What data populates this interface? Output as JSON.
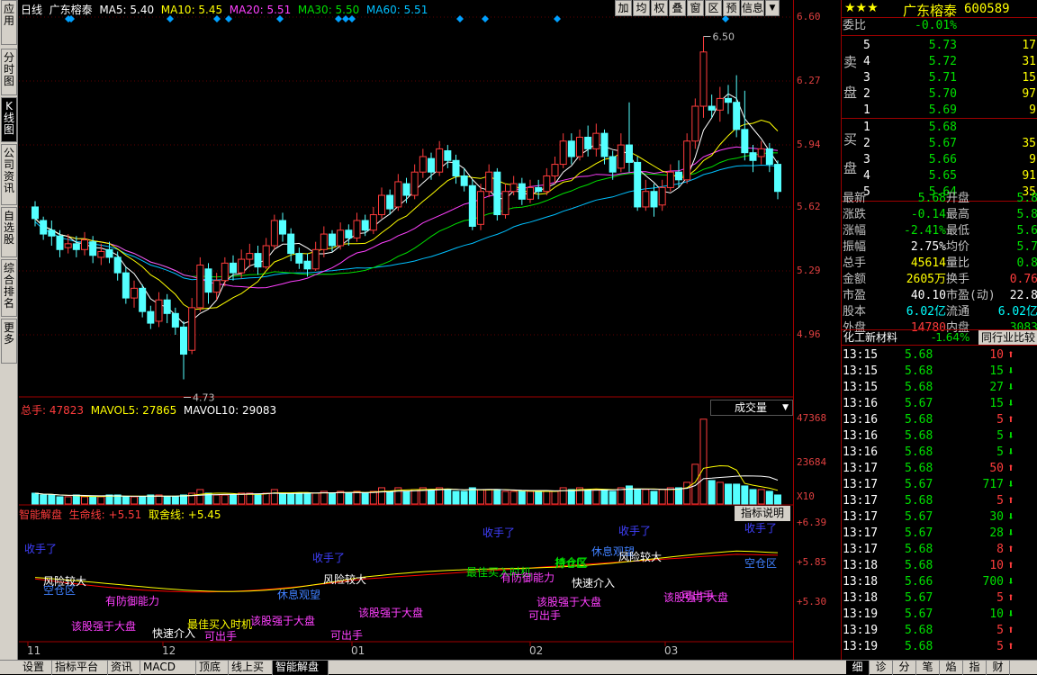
{
  "colors": {
    "up": "#ff3c3c",
    "down": "#54ffff",
    "ma5": "#ffffff",
    "ma10": "#ffff00",
    "ma20": "#ff40ff",
    "ma30": "#00e000",
    "ma60": "#00c0ff",
    "axis": "#a00000"
  },
  "left_tabs": [
    "应用",
    "分时图",
    "K线图",
    "公司资讯",
    "自选股",
    "综合排名",
    "更多"
  ],
  "header": {
    "period": "日线",
    "stock": "广东榕泰",
    "ma5": "MA5: 5.40",
    "ma10": "MA10: 5.45",
    "ma20": "MA20: 5.51",
    "ma30": "MA30: 5.50",
    "ma60": "MA60: 5.51"
  },
  "toolbar": [
    "加",
    "均",
    "权",
    "叠",
    "窗",
    "区",
    "预",
    "信息"
  ],
  "price_axis": [
    "6.60",
    "6.27",
    "5.94",
    "5.62",
    "5.29",
    "4.96"
  ],
  "candles": [
    [
      5.62,
      5.56,
      5.65,
      5.52
    ],
    [
      5.55,
      5.48,
      5.57,
      5.45
    ],
    [
      5.5,
      5.47,
      5.55,
      5.42
    ],
    [
      5.47,
      5.4,
      5.5,
      5.36
    ],
    [
      5.41,
      5.43,
      5.48,
      5.38
    ],
    [
      5.43,
      5.4,
      5.47,
      5.36
    ],
    [
      5.4,
      5.45,
      5.49,
      5.37
    ],
    [
      5.44,
      5.37,
      5.47,
      5.33
    ],
    [
      5.36,
      5.39,
      5.43,
      5.32
    ],
    [
      5.4,
      5.36,
      5.44,
      5.33
    ],
    [
      5.36,
      5.28,
      5.39,
      5.24
    ],
    [
      5.28,
      5.15,
      5.31,
      5.12
    ],
    [
      5.15,
      5.2,
      5.24,
      5.1
    ],
    [
      5.2,
      5.08,
      5.22,
      5.05
    ],
    [
      5.08,
      5.02,
      5.11,
      4.99
    ],
    [
      5.03,
      5.14,
      5.18,
      5.0
    ],
    [
      5.14,
      5.07,
      5.17,
      5.02
    ],
    [
      5.07,
      5.0,
      5.1,
      4.96
    ],
    [
      5.0,
      4.86,
      5.03,
      4.73
    ],
    [
      4.88,
      5.1,
      5.15,
      4.86
    ],
    [
      5.1,
      5.32,
      5.36,
      5.08
    ],
    [
      5.3,
      5.18,
      5.33,
      5.12
    ],
    [
      5.18,
      5.24,
      5.28,
      5.14
    ],
    [
      5.24,
      5.33,
      5.36,
      5.21
    ],
    [
      5.33,
      5.28,
      5.37,
      5.24
    ],
    [
      5.28,
      5.35,
      5.4,
      5.25
    ],
    [
      5.35,
      5.38,
      5.43,
      5.31
    ],
    [
      5.38,
      5.31,
      5.42,
      5.27
    ],
    [
      5.31,
      5.42,
      5.46,
      5.3
    ],
    [
      5.42,
      5.55,
      5.58,
      5.4
    ],
    [
      5.55,
      5.48,
      5.59,
      5.44
    ],
    [
      5.48,
      5.38,
      5.51,
      5.34
    ],
    [
      5.38,
      5.33,
      5.41,
      5.3
    ],
    [
      5.34,
      5.3,
      5.38,
      5.26
    ],
    [
      5.3,
      5.4,
      5.44,
      5.29
    ],
    [
      5.4,
      5.48,
      5.52,
      5.36
    ],
    [
      5.48,
      5.42,
      5.5,
      5.39
    ],
    [
      5.42,
      5.5,
      5.54,
      5.4
    ],
    [
      5.5,
      5.46,
      5.53,
      5.42
    ],
    [
      5.46,
      5.55,
      5.59,
      5.44
    ],
    [
      5.55,
      5.5,
      5.58,
      5.47
    ],
    [
      5.5,
      5.58,
      5.62,
      5.48
    ],
    [
      5.58,
      5.68,
      5.72,
      5.56
    ],
    [
      5.68,
      5.61,
      5.71,
      5.58
    ],
    [
      5.62,
      5.75,
      5.79,
      5.6
    ],
    [
      5.74,
      5.68,
      5.77,
      5.64
    ],
    [
      5.68,
      5.8,
      5.84,
      5.66
    ],
    [
      5.8,
      5.88,
      5.92,
      5.77
    ],
    [
      5.87,
      5.8,
      5.9,
      5.76
    ],
    [
      5.8,
      5.92,
      5.96,
      5.78
    ],
    [
      5.91,
      5.86,
      5.94,
      5.82
    ],
    [
      5.86,
      5.78,
      5.89,
      5.74
    ],
    [
      5.78,
      5.73,
      5.82,
      5.7
    ],
    [
      5.73,
      5.52,
      5.76,
      5.5
    ],
    [
      5.53,
      5.7,
      5.74,
      5.5
    ],
    [
      5.7,
      5.8,
      5.84,
      5.67
    ],
    [
      5.8,
      5.58,
      5.82,
      5.55
    ],
    [
      5.58,
      5.7,
      5.74,
      5.56
    ],
    [
      5.7,
      5.74,
      5.78,
      5.68
    ],
    [
      5.74,
      5.66,
      5.77,
      5.63
    ],
    [
      5.66,
      5.72,
      5.76,
      5.64
    ],
    [
      5.72,
      5.7,
      5.76,
      5.66
    ],
    [
      5.7,
      5.78,
      5.82,
      5.68
    ],
    [
      5.78,
      5.84,
      5.88,
      5.74
    ],
    [
      5.84,
      5.96,
      6.0,
      5.82
    ],
    [
      5.96,
      5.88,
      6.0,
      5.84
    ],
    [
      5.88,
      5.98,
      6.02,
      5.86
    ],
    [
      5.98,
      5.92,
      6.04,
      5.88
    ],
    [
      5.92,
      6.0,
      6.05,
      5.88
    ],
    [
      6.0,
      5.88,
      6.02,
      5.84
    ],
    [
      5.88,
      5.8,
      5.91,
      5.76
    ],
    [
      5.82,
      5.94,
      6.0,
      5.8
    ],
    [
      5.94,
      5.85,
      6.16,
      5.8
    ],
    [
      5.85,
      5.62,
      5.88,
      5.6
    ],
    [
      5.62,
      5.7,
      5.76,
      5.6
    ],
    [
      5.7,
      5.62,
      5.74,
      5.57
    ],
    [
      5.63,
      5.72,
      5.76,
      5.6
    ],
    [
      5.72,
      5.8,
      5.84,
      5.7
    ],
    [
      5.8,
      5.76,
      5.86,
      5.72
    ],
    [
      5.76,
      5.96,
      6.0,
      5.74
    ],
    [
      5.96,
      6.14,
      6.18,
      5.92
    ],
    [
      6.14,
      6.42,
      6.5,
      6.08
    ],
    [
      6.14,
      6.12,
      6.2,
      6.08
    ],
    [
      6.12,
      6.18,
      6.24,
      6.06
    ],
    [
      6.18,
      6.16,
      6.25,
      6.1
    ],
    [
      6.16,
      6.02,
      6.3,
      5.98
    ],
    [
      6.02,
      5.9,
      6.22,
      5.86
    ],
    [
      5.9,
      5.86,
      5.94,
      5.8
    ],
    [
      5.88,
      5.92,
      5.96,
      5.84
    ],
    [
      5.92,
      5.84,
      5.95,
      5.8
    ],
    [
      5.84,
      5.7,
      5.86,
      5.66
    ]
  ],
  "price_labels": {
    "high": "6.50",
    "low": "4.73"
  },
  "volume_header": {
    "total": "总手: 47823",
    "mavol5": "MAVOL5: 27865",
    "mavol10": "MAVOL10: 29083",
    "dropdown": "成交量"
  },
  "volume_axis": [
    "47368",
    "23684",
    "X10"
  ],
  "volumes": [
    6,
    5,
    5,
    4,
    4,
    5,
    4,
    4,
    4,
    5,
    5,
    4,
    4,
    4,
    5,
    5,
    4,
    4,
    5,
    6,
    8,
    6,
    5,
    5,
    5,
    6,
    6,
    5,
    6,
    8,
    6,
    6,
    6,
    6,
    6,
    7,
    6,
    7,
    6,
    7,
    6,
    7,
    9,
    7,
    9,
    7,
    8,
    9,
    8,
    9,
    8,
    7,
    7,
    9,
    8,
    8,
    8,
    7,
    7,
    7,
    7,
    7,
    7,
    7,
    9,
    8,
    9,
    8,
    8,
    8,
    7,
    9,
    10,
    8,
    8,
    7,
    8,
    9,
    9,
    12,
    22,
    47,
    13,
    12,
    11,
    11,
    10,
    8,
    8,
    7,
    5
  ],
  "indicator": {
    "title": "智能解盘",
    "life_line": "生命线: +5.51",
    "decision_line": "取舍线: +5.45",
    "explain_btn": "指标说明",
    "axis": [
      "+6.39",
      "+5.85",
      "+5.30"
    ]
  },
  "signals": [
    {
      "text": "收手了",
      "color": "#4040ff"
    },
    {
      "text": "风险较大",
      "color": "#ffffff"
    },
    {
      "text": "空仓区",
      "color": "#4080ff"
    },
    {
      "text": "有防御能力",
      "color": "#ff40ff"
    },
    {
      "text": "该股强于大盘",
      "color": "#ff40ff"
    },
    {
      "text": "快速介入",
      "color": "#ffffff"
    },
    {
      "text": "最佳买入时机",
      "color": "#ffff00"
    },
    {
      "text": "可出手",
      "color": "#ff40ff"
    },
    {
      "text": "持仓区",
      "color": "#00e000"
    },
    {
      "text": "该股强于大盘",
      "color": "#ff40ff"
    },
    {
      "text": "休息观望",
      "color": "#4080ff"
    },
    {
      "text": "收手了",
      "color": "#4040ff"
    },
    {
      "text": "风险较大",
      "color": "#ffffff"
    },
    {
      "text": "该股强于大盘",
      "color": "#ff40ff"
    },
    {
      "text": "可出手",
      "color": "#ff40ff"
    },
    {
      "text": "收手了",
      "color": "#4040ff"
    },
    {
      "text": "最佳买入时机",
      "color": "#00e000"
    },
    {
      "text": "有防御能力",
      "color": "#ff40ff"
    },
    {
      "text": "快速介入",
      "color": "#ffffff"
    },
    {
      "text": "持仓区",
      "color": "#00e000"
    },
    {
      "text": "该股强于大盘",
      "color": "#ff40ff"
    },
    {
      "text": "可出手",
      "color": "#ff40ff"
    },
    {
      "text": "收手了",
      "color": "#4040ff"
    },
    {
      "text": "休息观望",
      "color": "#4080ff"
    },
    {
      "text": "风险较大",
      "color": "#ffffff"
    },
    {
      "text": "该股强于大盘",
      "color": "#ff40ff"
    },
    {
      "text": "可出手",
      "color": "#ff40ff"
    },
    {
      "text": "收手了",
      "color": "#4040ff"
    },
    {
      "text": "空仓区",
      "color": "#4080ff"
    }
  ],
  "x_axis": [
    "11",
    "12",
    "01",
    "02",
    "03"
  ],
  "bottom_tabs": [
    "设置",
    "指标平台",
    "资讯",
    "MACD",
    "顶底",
    "线上买",
    "智能解盘"
  ],
  "quote": {
    "name": "广东榕泰",
    "code": "600589",
    "weibi_label": "委比",
    "weibi": "-0.01%",
    "sell": [
      [
        "5",
        "5.73",
        "17"
      ],
      [
        "4",
        "5.72",
        "31"
      ],
      [
        "3",
        "5.71",
        "15"
      ],
      [
        "2",
        "5.70",
        "97"
      ],
      [
        "1",
        "5.69",
        "9"
      ]
    ],
    "buy": [
      [
        "1",
        "5.68",
        ""
      ],
      [
        "2",
        "5.67",
        "35"
      ],
      [
        "3",
        "5.66",
        "9"
      ],
      [
        "4",
        "5.65",
        "91"
      ],
      [
        "5",
        "5.64",
        "35"
      ]
    ],
    "sell_label": [
      "卖",
      "盘"
    ],
    "buy_label": [
      "买",
      "盘"
    ],
    "stats": [
      [
        "最新",
        "5.68",
        "开盘",
        "5.8"
      ],
      [
        "涨跌",
        "-0.14",
        "最高",
        "5.8"
      ],
      [
        "涨幅",
        "-2.41%",
        "最低",
        "5.6"
      ],
      [
        "振幅",
        "2.75%",
        "均价",
        "5.7"
      ],
      [
        "总手",
        "45614",
        "量比",
        "0.8"
      ],
      [
        "金额",
        "2605万",
        "换手",
        "0.76"
      ],
      [
        "市盈",
        "40.10",
        "市盈(动)",
        "22.8"
      ],
      [
        "股本",
        "6.02亿",
        "流通",
        "6.02亿"
      ],
      [
        "外盘",
        "14780",
        "内盘",
        "3083"
      ]
    ],
    "sector": "化工新材料",
    "sector_change": "-1.64%",
    "sector_btn": "同行业比较",
    "ticks": [
      [
        "13:15",
        "5.68",
        "10",
        "up"
      ],
      [
        "13:15",
        "5.68",
        "15",
        "down"
      ],
      [
        "13:15",
        "5.68",
        "27",
        "down"
      ],
      [
        "13:16",
        "5.67",
        "15",
        "down"
      ],
      [
        "13:16",
        "5.68",
        "5",
        "up"
      ],
      [
        "13:16",
        "5.68",
        "5",
        "down"
      ],
      [
        "13:16",
        "5.68",
        "5",
        "down"
      ],
      [
        "13:17",
        "5.68",
        "50",
        "up"
      ],
      [
        "13:17",
        "5.67",
        "717",
        "down"
      ],
      [
        "13:17",
        "5.68",
        "5",
        "up"
      ],
      [
        "13:17",
        "5.67",
        "30",
        "down"
      ],
      [
        "13:17",
        "5.67",
        "28",
        "down"
      ],
      [
        "13:17",
        "5.68",
        "8",
        "up"
      ],
      [
        "13:18",
        "5.68",
        "10",
        "up"
      ],
      [
        "13:18",
        "5.66",
        "700",
        "down"
      ],
      [
        "13:18",
        "5.67",
        "5",
        "up"
      ],
      [
        "13:19",
        "5.67",
        "10",
        "down"
      ],
      [
        "13:19",
        "5.68",
        "5",
        "up"
      ],
      [
        "13:19",
        "5.68",
        "5",
        "up"
      ]
    ],
    "bottom_tabs": [
      "细",
      "诊",
      "分",
      "笔",
      "焰",
      "指",
      "财"
    ]
  }
}
